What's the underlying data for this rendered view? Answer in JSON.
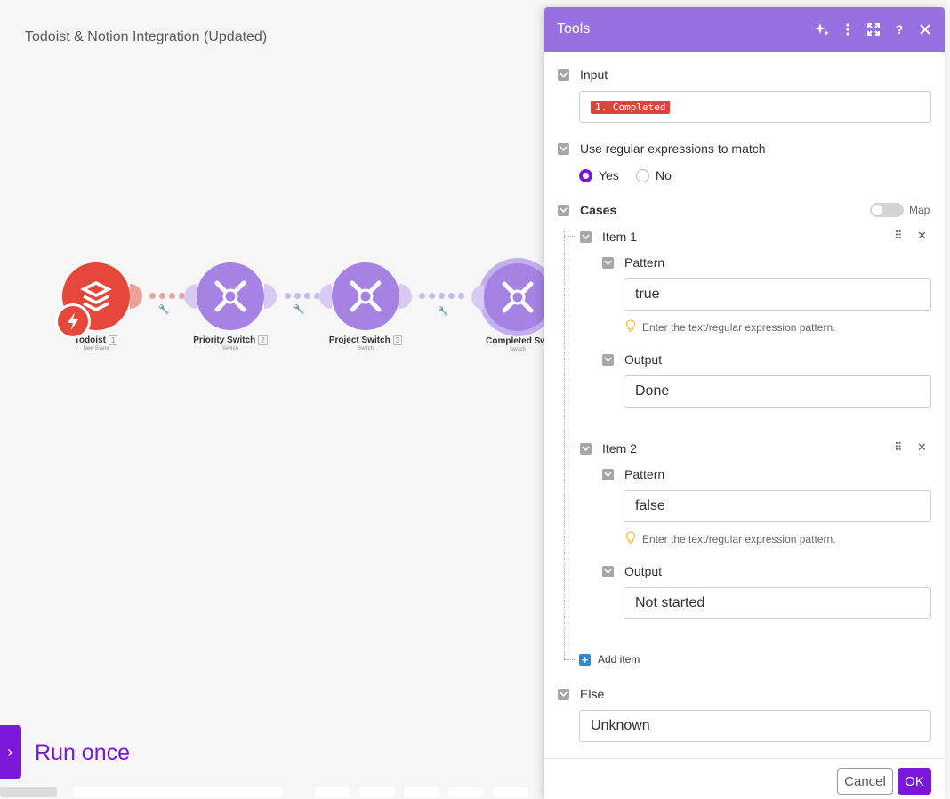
{
  "scenario": {
    "title": "Todoist & Notion Integration (Updated)"
  },
  "nodes": [
    {
      "label": "Todoist",
      "num": "1",
      "sub": "New Event"
    },
    {
      "label": "Priority Switch",
      "num": "2",
      "sub": "Switch"
    },
    {
      "label": "Project Switch",
      "num": "3",
      "sub": "Switch"
    },
    {
      "label": "Completed Swi",
      "sub": "Switch"
    }
  ],
  "run": {
    "label": "Run once",
    "icon": "play-icon"
  },
  "panel": {
    "title": "Tools",
    "header_icons": [
      "ai-sparkle-icon",
      "more-vertical-icon",
      "expand-icon",
      "help-icon",
      "close-icon"
    ],
    "input": {
      "label": "Input",
      "pill": "1. Completed"
    },
    "regex": {
      "label": "Use regular expressions to match",
      "yes": "Yes",
      "no": "No",
      "selected": "Yes"
    },
    "cases": {
      "label": "Cases",
      "map_label": "Map",
      "items": [
        {
          "title": "Item 1",
          "pattern_label": "Pattern",
          "pattern_value": "true",
          "hint": "Enter the text/regular expression pattern.",
          "output_label": "Output",
          "output_value": "Done"
        },
        {
          "title": "Item 2",
          "pattern_label": "Pattern",
          "pattern_value": "false",
          "hint": "Enter the text/regular expression pattern.",
          "output_label": "Output",
          "output_value": "Not started"
        }
      ],
      "add_item": "Add item"
    },
    "else": {
      "label": "Else",
      "value": "Unknown"
    },
    "footer": {
      "cancel": "Cancel",
      "ok": "OK"
    },
    "colors": {
      "header": "#9670e0",
      "accent": "#7a17d8",
      "pill": "#d8473a"
    }
  }
}
